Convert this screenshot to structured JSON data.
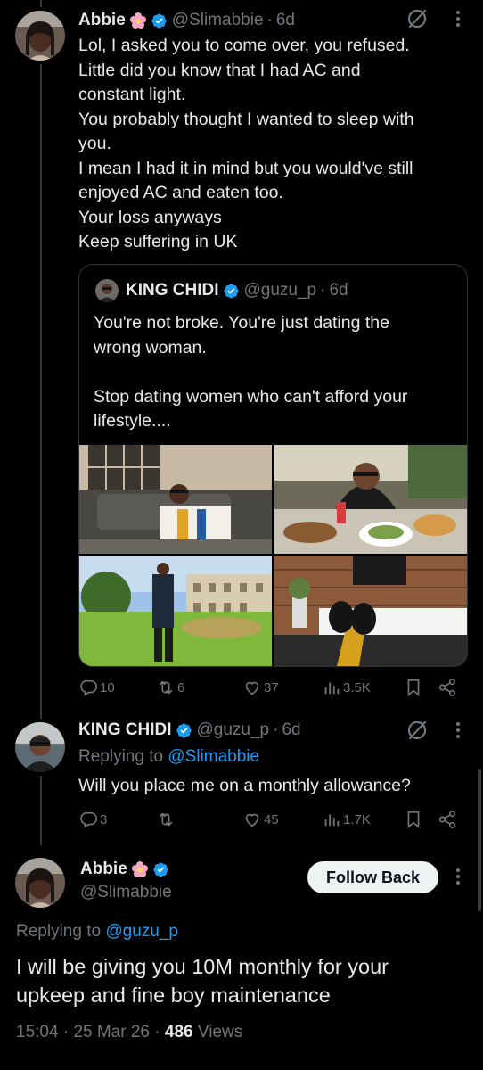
{
  "colors": {
    "background": "#000000",
    "text": "#e7e9ea",
    "muted": "#71767b",
    "accent": "#1d9bf0",
    "verified": "#1d9bf0",
    "button_bg": "#eff3f4"
  },
  "tweet1": {
    "name": "Abbie",
    "handle": "@Slimabbie",
    "separator": "·",
    "time": "6d",
    "icons": [
      "flower-emoji-icon",
      "verified-badge-icon",
      "grok-icon",
      "more-icon"
    ],
    "text": "Lol, I asked you to come over, you refused.\nLittle did you know that I had AC and\nconstant light.\nYou probably thought I wanted to sleep with\nyou.\nI mean I had it in mind but you would've still\nenjoyed AC and eaten too.\nYour loss anyways\nKeep suffering in UK",
    "quote": {
      "name": "KING CHIDI",
      "handle": "@guzu_p",
      "separator": "·",
      "time": "6d",
      "text": "You're not broke. You're just dating the\nwrong woman.\n\nStop dating women who can't afford your\nlifestyle....",
      "photos": [
        "man-on-sofa-photo",
        "dining-table-photo",
        "estate-lawn-photo",
        "feet-on-table-photo"
      ]
    },
    "actions": {
      "replies": "10",
      "reposts": "6",
      "likes": "37",
      "views": "3.5K"
    }
  },
  "tweet2": {
    "name": "KING CHIDI",
    "handle": "@guzu_p",
    "separator": "·",
    "time": "6d",
    "replying_prefix": "Replying to",
    "replying_to": "@Slimabbie",
    "text": "Will you place me on a monthly allowance?",
    "actions": {
      "replies": "3",
      "reposts": "",
      "likes": "45",
      "views": "1.7K"
    }
  },
  "main_tweet": {
    "name": "Abbie",
    "handle": "@Slimabbie",
    "follow_label": "Follow Back",
    "replying_prefix": "Replying to",
    "replying_to": "@guzu_p",
    "text": "I will be giving you 10M monthly for your\nupkeep and fine boy maintenance",
    "time": "15:04",
    "separator": "·",
    "date": "25 Mar 26",
    "separator2": "·",
    "views_count": "486",
    "views_label": "Views"
  }
}
